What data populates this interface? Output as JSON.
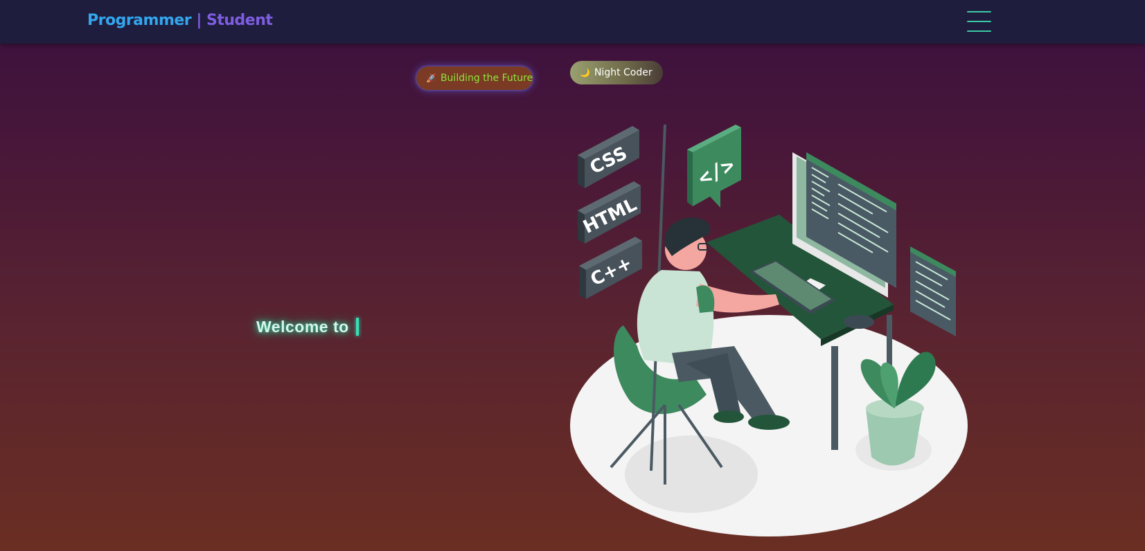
{
  "nav": {
    "brand_part1": "Programmer",
    "brand_sep": " | ",
    "brand_part2": "Student",
    "menu_icon": "hamburger-menu-icon"
  },
  "badges": {
    "future": {
      "icon": "rocket-icon",
      "emoji": "🚀",
      "label": "Building the Future"
    },
    "night": {
      "icon": "moon-icon",
      "emoji": "🌙",
      "label": "Night Coder"
    }
  },
  "hero": {
    "welcome": "Welcome to"
  },
  "illustration": {
    "css_label": "CSS",
    "html_label": "HTML",
    "cpp_label": "C++",
    "code_bubble": "</>"
  },
  "colors": {
    "brand_blue": "#33a6ee",
    "brand_purple": "#7e5de0",
    "accent_teal": "#3cc9a6",
    "badge_green_text": "#8ce63a",
    "illustration_green": "#3d8a5e"
  }
}
